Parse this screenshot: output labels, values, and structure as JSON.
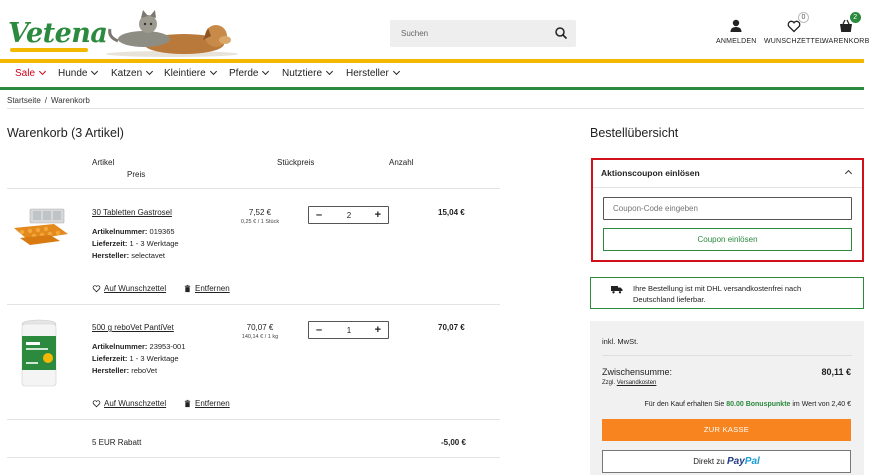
{
  "header": {
    "logo_text": "Vetena",
    "search_placeholder": "Suchen",
    "login_label": "ANMELDEN",
    "wishlist_label": "WUNSCHZETTEL",
    "wishlist_count": "0",
    "cart_label": "WARENKORB",
    "cart_count": "2"
  },
  "nav": {
    "items": [
      "Sale",
      "Hunde",
      "Katzen",
      "Kleintiere",
      "Pferde",
      "Nutztiere",
      "Hersteller"
    ]
  },
  "breadcrumb": {
    "home": "Startseite",
    "separator": "/",
    "current": "Warenkorb"
  },
  "cart": {
    "title": "Warenkorb (3 Artikel)",
    "col_article": "Artikel",
    "col_price": "Preis",
    "col_unit_price": "Stückpreis",
    "col_quantity": "Anzahl",
    "items": [
      {
        "name": "30 Tabletten Gastrosel",
        "article_label": "Artikelnummer:",
        "article_no": "019365",
        "delivery_label": "Lieferzeit:",
        "delivery": "1 - 3 Werktage",
        "manufacturer_label": "Hersteller:",
        "manufacturer": "selectavet",
        "price": "7,52 €",
        "unit_price": "0,25 € / 1 Stück",
        "quantity": "2",
        "total": "15,04 €",
        "wishlist_link": "Auf Wunschzettel",
        "remove_link": "Entfernen"
      },
      {
        "name": "500 g reboVet PantiVet",
        "article_label": "Artikelnummer:",
        "article_no": "23953-001",
        "delivery_label": "Lieferzeit:",
        "delivery": "1 - 3 Werktage",
        "manufacturer_label": "Hersteller:",
        "manufacturer": "reboVet",
        "price": "70,07 €",
        "unit_price": "140,14 € / 1 kg",
        "quantity": "1",
        "total": "70,07 €",
        "wishlist_link": "Auf Wunschzettel",
        "remove_link": "Entfernen"
      }
    ],
    "discount_label": "5 EUR Rabatt",
    "discount_value": "-5,00 €"
  },
  "summary": {
    "title": "Bestellübersicht",
    "coupon_title": "Aktionscoupon einlösen",
    "coupon_placeholder": "Coupon-Code eingeben",
    "coupon_button": "Coupon einlösen",
    "shipping_info": "Ihre Bestellung ist mit DHL versandkostenfrei nach Deutschland lieferbar.",
    "vat": "inkl. MwSt.",
    "subtotal_label": "Zwischensumme:",
    "subtotal_value": "80,11 €",
    "shipping_prefix": "Zzgl.",
    "shipping_link": "Versandkosten",
    "bonus_prefix": "Für den Kauf erhalten Sie",
    "bonus_points": "80.00 Bonuspunkte",
    "bonus_suffix": "im Wert von 2,40 €",
    "checkout_button": "ZUR KASSE",
    "paypal_prefix": "Direkt zu",
    "paypal_brand_1": "Pay",
    "paypal_brand_2": "Pal"
  },
  "colors": {
    "brand_green": "#2b8a3e",
    "brand_yellow": "#f5b800",
    "sale_red": "#d0021b",
    "checkout_orange": "#f7841e",
    "coupon_highlight": "#d0101a"
  }
}
